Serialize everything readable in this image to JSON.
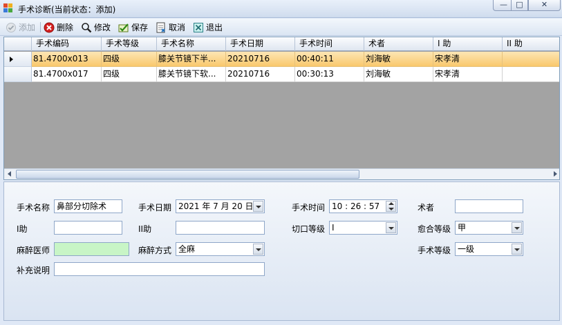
{
  "window": {
    "title": "手术诊断(当前状态：添加)",
    "min_glyph": "—",
    "max_glyph": "□",
    "close_glyph": "✕"
  },
  "toolbar": {
    "add": "添加",
    "delete": "删除",
    "edit": "修改",
    "save": "保存",
    "cancel": "取消",
    "exit": "退出"
  },
  "grid": {
    "columns": [
      "手术编码",
      "手术等级",
      "手术名称",
      "手术日期",
      "手术时间",
      "术者",
      "I 助",
      "II 助"
    ],
    "rows": [
      [
        "81.4700x013",
        "四级",
        "膝关节镜下半...",
        "20210716",
        "00:40:11",
        "刘海敏",
        "宋孝清",
        ""
      ],
      [
        "81.4700x017",
        "四级",
        "膝关节镜下软...",
        "20210716",
        "00:30:13",
        "刘海敏",
        "宋孝清",
        ""
      ]
    ],
    "selected_row": 0
  },
  "form": {
    "surgery_name": {
      "label": "手术名称",
      "value": "鼻部分切除术"
    },
    "surgery_date": {
      "label": "手术日期",
      "value": "2021 年 7 月 20 日"
    },
    "surgery_time": {
      "label": "手术时间",
      "value": "10 : 26 : 57"
    },
    "surgeon": {
      "label": "术者",
      "value": ""
    },
    "assistant1": {
      "label": "I助",
      "value": ""
    },
    "assistant2": {
      "label": "II助",
      "value": ""
    },
    "incision_grade": {
      "label": "切口等级",
      "value": "I"
    },
    "healing_grade": {
      "label": "愈合等级",
      "value": "甲"
    },
    "anesthetist": {
      "label": "麻醉医师",
      "value": ""
    },
    "anesthesia_method": {
      "label": "麻醉方式",
      "value": "全麻"
    },
    "surgery_level": {
      "label": "手术等级",
      "value": "一级"
    },
    "notes": {
      "label": "补充说明",
      "value": ""
    }
  },
  "colors": {
    "selected_row": "#f9c86c",
    "anesthetist_field": "#c8f5c6",
    "grid_background": "#a3a3a3"
  }
}
